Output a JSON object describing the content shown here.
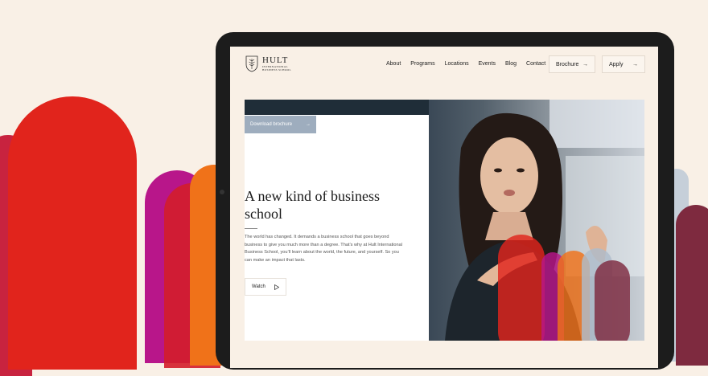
{
  "header": {
    "logo_name": "HULT",
    "logo_sub_line1": "INTERNATIONAL",
    "logo_sub_line2": "BUSINESS SCHOOL",
    "nav": [
      "About",
      "Programs",
      "Locations",
      "Events",
      "Blog",
      "Contact"
    ],
    "brochure_label": "Brochure",
    "apply_label": "Apply"
  },
  "hero": {
    "download_label": "Download brochure",
    "headline": "A new kind of business school",
    "body": "The world has changed. It demands a business school that goes beyond business to give you much more than a degree. That’s why at Hult International Business School, you’ll learn about the world, the future, and yourself. So you can make an impact that lasts.",
    "watch_label": "Watch"
  },
  "icons": {
    "arrow": "arrow-right-icon",
    "play": "play-icon",
    "logo": "hult-crest-icon"
  },
  "colors": {
    "background": "#f9f0e6",
    "red": "#e1241c",
    "magenta": "#b8168a",
    "orange": "#f07219",
    "download_btn": "#9eadbe"
  }
}
